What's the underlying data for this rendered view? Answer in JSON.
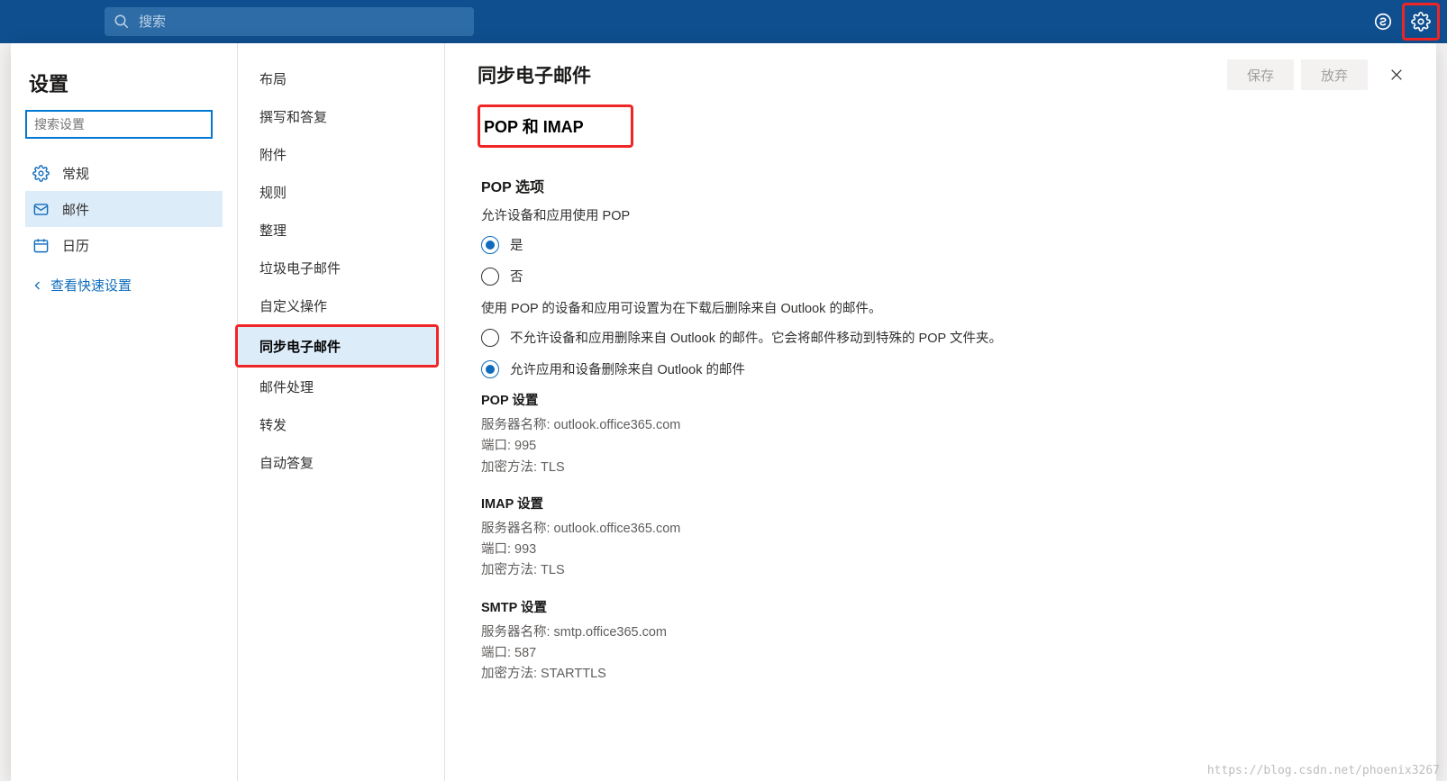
{
  "topbar": {
    "search_placeholder": "搜索"
  },
  "categories": {
    "title": "设置",
    "search_placeholder": "搜索设置",
    "items": [
      {
        "label": "常规",
        "icon": "gear"
      },
      {
        "label": "邮件",
        "icon": "mail"
      },
      {
        "label": "日历",
        "icon": "calendar"
      }
    ],
    "quick_link": "查看快速设置"
  },
  "sub": {
    "items": [
      "布局",
      "撰写和答复",
      "附件",
      "规则",
      "整理",
      "垃圾电子邮件",
      "自定义操作",
      "同步电子邮件",
      "邮件处理",
      "转发",
      "自动答复"
    ]
  },
  "main": {
    "title": "同步电子邮件",
    "save": "保存",
    "discard": "放弃",
    "section_head": "POP 和 IMAP",
    "pop_options": {
      "head": "POP 选项",
      "allow_label": "允许设备和应用使用 POP",
      "yes": "是",
      "no": "否",
      "delete_desc": "使用 POP 的设备和应用可设置为在下载后删除来自 Outlook 的邮件。",
      "opt_no_delete": "不允许设备和应用删除来自 Outlook 的邮件。它会将邮件移动到特殊的 POP 文件夹。",
      "opt_allow_delete": "允许应用和设备删除来自 Outlook 的邮件"
    },
    "pop_settings": {
      "head": "POP 设置",
      "server": "服务器名称: outlook.office365.com",
      "port": "端口: 995",
      "enc": "加密方法: TLS"
    },
    "imap_settings": {
      "head": "IMAP 设置",
      "server": "服务器名称: outlook.office365.com",
      "port": "端口: 993",
      "enc": "加密方法: TLS"
    },
    "smtp_settings": {
      "head": "SMTP 设置",
      "server": "服务器名称: smtp.office365.com",
      "port": "端口: 587",
      "enc": "加密方法: STARTTLS"
    }
  },
  "watermark": "https://blog.csdn.net/phoenix3267"
}
